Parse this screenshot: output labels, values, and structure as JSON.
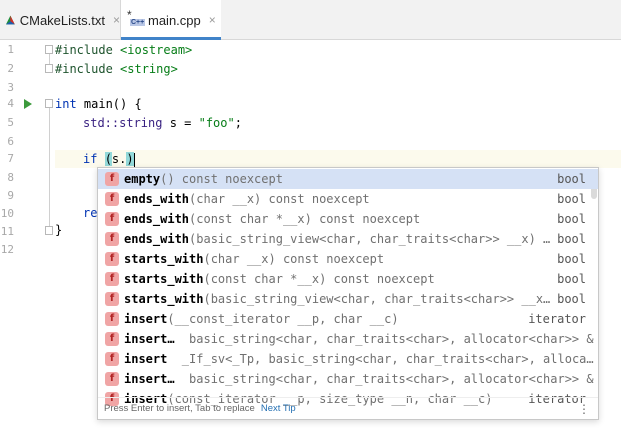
{
  "tabs": [
    {
      "label": "CMakeLists.txt",
      "icon": "cmake-icon",
      "close": "×"
    },
    {
      "label": "main.cpp",
      "icon": "cpp-file-icon",
      "close": "×",
      "active": true,
      "icon_star": "*",
      "icon_badge": "C++"
    }
  ],
  "gutter": {
    "line_numbers": [
      "1",
      "2",
      "3",
      "4",
      "5",
      "6",
      "7",
      "8",
      "9",
      "10",
      "11",
      "12"
    ]
  },
  "code": {
    "line1_pp": "#include",
    "line1_inc": "<iostream>",
    "line2_pp": "#include",
    "line2_inc": "<string>",
    "line4_kw": "int",
    "line4_rest": " main() {",
    "line5_ns": "std::",
    "line5_type": "string",
    "line5_var": " s = ",
    "line5_str": "\"foo\"",
    "line5_end": ";",
    "line7_kw": "if",
    "line7_paren": "(",
    "line7_rest": "s.",
    "line7_close": ")",
    "line9_partial": "re",
    "line11_brace": "}"
  },
  "completion": {
    "items": [
      {
        "name": "empty",
        "sig": "() const noexcept",
        "type": "bool"
      },
      {
        "name": "ends_with",
        "sig": "(char __x) const noexcept",
        "type": "bool"
      },
      {
        "name": "ends_with",
        "sig": "(const char *__x) const noexcept",
        "type": "bool"
      },
      {
        "name": "ends_with",
        "sig": "(basic_string_view<char, char_traits<char>> __x) …",
        "type": "bool"
      },
      {
        "name": "starts_with",
        "sig": "(char __x) const noexcept",
        "type": "bool"
      },
      {
        "name": "starts_with",
        "sig": "(const char *__x) const noexcept",
        "type": "bool"
      },
      {
        "name": "starts_with",
        "sig": "(basic_string_view<char, char_traits<char>> __x…",
        "type": "bool"
      },
      {
        "name": "insert",
        "sig": "(__const_iterator __p, char __c)",
        "type": "iterator"
      },
      {
        "name": "insert…",
        "sig": "  basic_string<char, char_traits<char>, allocator<char>> &",
        "type": ""
      },
      {
        "name": "insert",
        "sig": "  _If_sv<_Tp, basic_string<char, char_traits<char>, alloca…",
        "type": ""
      },
      {
        "name": "insert…",
        "sig": "  basic_string<char, char_traits<char>, allocator<char>> &",
        "type": ""
      },
      {
        "name": "insert",
        "sig": "(const_iterator __p, size_type __n, char __c)",
        "type": "iterator"
      }
    ],
    "icon_letter": "f",
    "footer_text": "Press Enter to insert, Tab to replace",
    "footer_tip": "Next Tip",
    "footer_menu": "⋮"
  }
}
